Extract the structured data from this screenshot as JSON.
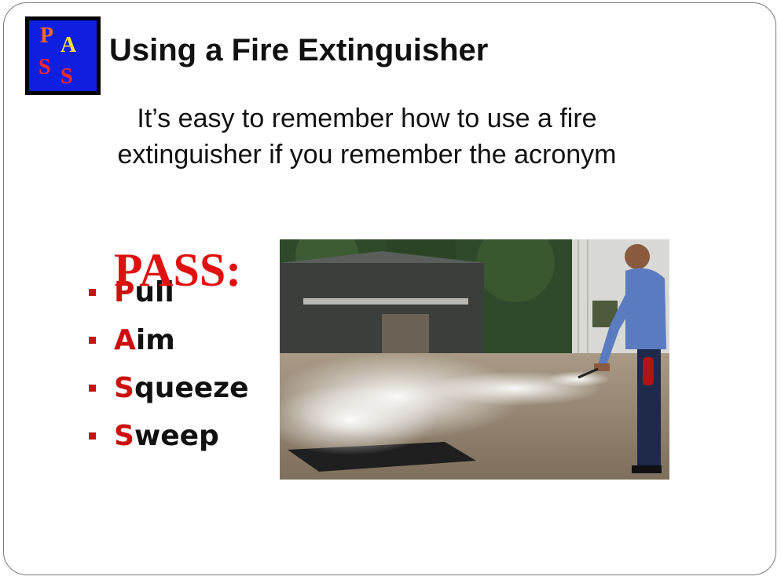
{
  "logo": {
    "letters": [
      "P",
      "A",
      "S",
      "S"
    ],
    "colors": {
      "p": "#ff6a1a",
      "a": "#ffe23a",
      "s": "#ff2a2a",
      "background": "#0f1fe0"
    }
  },
  "title": "Using a Fire Extinguisher",
  "intro": {
    "line1": "It’s easy to remember how to use a fire",
    "line2": "extinguisher if you remember the acronym"
  },
  "acronym": {
    "letters": "PASS",
    "colon": ":",
    "color": "#e01010"
  },
  "steps": [
    {
      "initial": "P",
      "rest": "ull"
    },
    {
      "initial": "A",
      "rest": "im"
    },
    {
      "initial": "S",
      "rest": "queeze"
    },
    {
      "initial": "S",
      "rest": "weep"
    }
  ],
  "photo": {
    "subject": "firefighter-using-extinguisher"
  }
}
